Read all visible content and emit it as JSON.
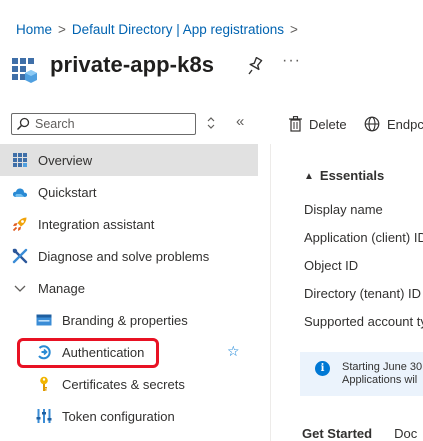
{
  "breadcrumb": {
    "items": [
      "Home",
      "Default Directory | App registrations"
    ],
    "separator": ">"
  },
  "header": {
    "title": "private-app-k8s",
    "more": "···"
  },
  "search": {
    "placeholder": "Search"
  },
  "toolbar": {
    "delete_label": "Delete",
    "endpoints_label": "Endpc"
  },
  "nav": {
    "items": [
      {
        "label": "Overview",
        "icon": "grid-icon",
        "active": true
      },
      {
        "label": "Quickstart",
        "icon": "cloud-icon"
      },
      {
        "label": "Integration assistant",
        "icon": "rocket-icon"
      },
      {
        "label": "Diagnose and solve problems",
        "icon": "tools-icon"
      },
      {
        "label": "Manage",
        "icon": "chevron-down-icon"
      },
      {
        "label": "Branding & properties",
        "icon": "branding-icon"
      },
      {
        "label": "Authentication",
        "icon": "authentication-icon"
      },
      {
        "label": "Certificates & secrets",
        "icon": "key-icon"
      },
      {
        "label": "Token configuration",
        "icon": "token-icon"
      }
    ]
  },
  "essentials": {
    "title": "Essentials",
    "fields": [
      "Display name",
      "Application (client) ID",
      "Object ID",
      "Directory (tenant) ID",
      "Supported account ty"
    ]
  },
  "info": {
    "line1": "Starting June 30",
    "line2": "Applications wil"
  },
  "tabs": [
    "Get Started",
    "Doc"
  ],
  "colors": {
    "link": "#0063b1",
    "accent": "#0078d4",
    "highlight_border": "#e81123",
    "active_bg": "#e1e1e1",
    "info_bg": "#ebf3fc"
  }
}
